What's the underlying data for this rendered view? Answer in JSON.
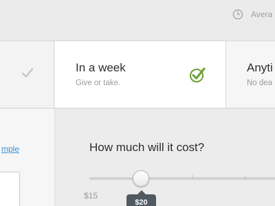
{
  "header": {
    "average_label": "Avera",
    "icon": "clock-icon"
  },
  "options": [
    {
      "title": "",
      "subtitle": "",
      "selected": false,
      "icon": "check-icon"
    },
    {
      "title": "In a week",
      "subtitle": "Give or take.",
      "selected": true,
      "icon": "check-circle-icon"
    },
    {
      "title": "Anyti",
      "subtitle": "No dea",
      "selected": false
    }
  ],
  "sidebar": {
    "link_text": "mple"
  },
  "cost": {
    "question": "How much will it cost?",
    "min_label": "$15",
    "current_value_label": "$20",
    "current_value": 20,
    "min_value": 15
  },
  "colors": {
    "accent_check": "#6aa033",
    "link": "#3b8fd0",
    "tooltip_bg": "#525a61"
  }
}
